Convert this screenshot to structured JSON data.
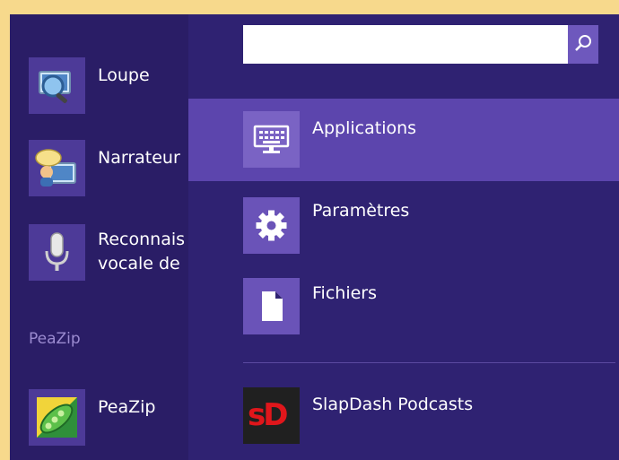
{
  "apps": [
    {
      "label": "Loupe",
      "icon": "magnifier-icon"
    },
    {
      "label": "Narrateur",
      "icon": "narrator-icon"
    },
    {
      "label_line1": "Reconnais",
      "label_line2": "vocale de",
      "icon": "microphone-icon"
    }
  ],
  "group_label": "PeaZip",
  "peazip": {
    "label": "PeaZip",
    "icon": "peazip-icon"
  },
  "search": {
    "value": "",
    "placeholder": ""
  },
  "scopes": [
    {
      "label": "Applications",
      "icon": "keyboard-monitor-icon",
      "selected": true
    },
    {
      "label": "Paramètres",
      "icon": "gear-icon",
      "selected": false
    },
    {
      "label": "Fichiers",
      "icon": "file-icon",
      "selected": false
    }
  ],
  "result": {
    "label": "SlapDash Podcasts",
    "tile_text": "sD"
  },
  "colors": {
    "background": "#2c1f6b",
    "selected": "#5c45ad",
    "tile": "#4d3a98",
    "frame": "#f7d98c"
  }
}
